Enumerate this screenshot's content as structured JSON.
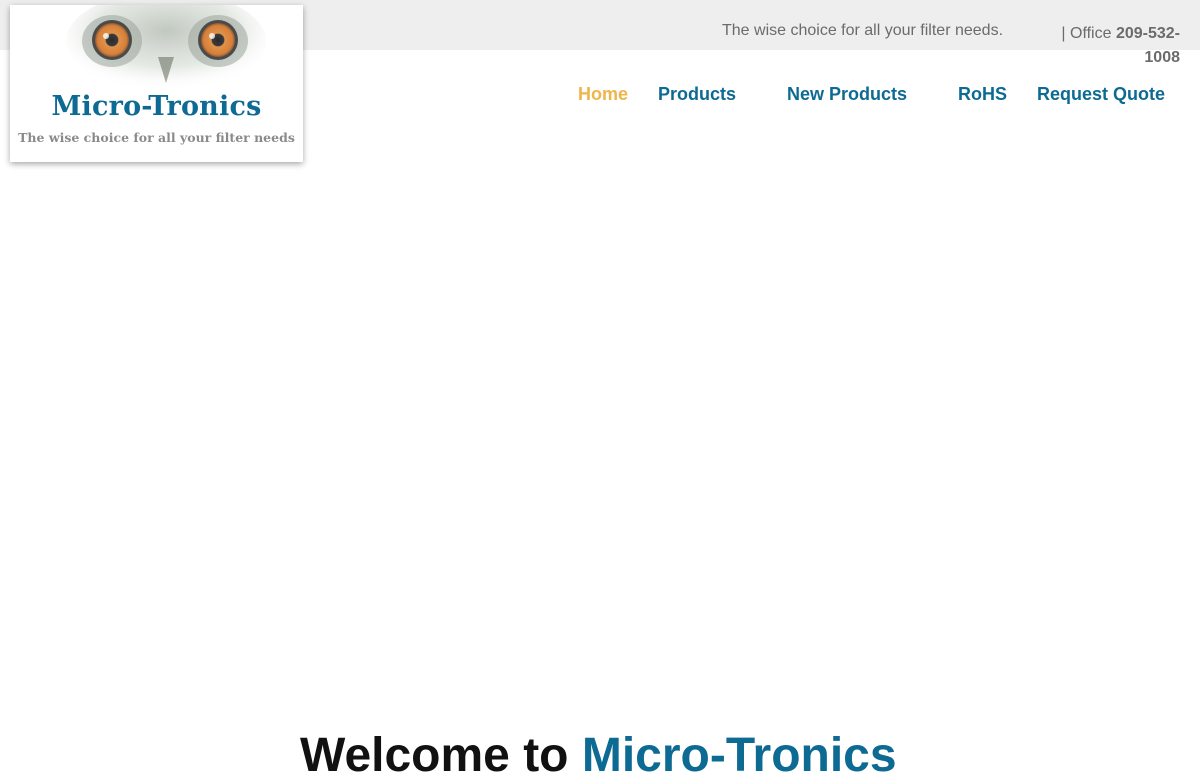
{
  "header": {
    "tagline": "The wise choice for all your filter needs.",
    "office_label": "| Office",
    "office_phone": "209-532-1008"
  },
  "logo": {
    "icon": "owl-eyes-icon",
    "name": "Micro-Tronics",
    "subtitle": "The wise choice for all your filter needs"
  },
  "nav": {
    "items": [
      {
        "label": "Home",
        "active": true
      },
      {
        "label": "Products",
        "active": false
      },
      {
        "label": "New Products",
        "active": false
      },
      {
        "label": "RoHS",
        "active": false
      },
      {
        "label": "Request Quote",
        "active": false
      }
    ]
  },
  "hero": {
    "welcome_prefix": "Welcome to",
    "welcome_brand": "Micro-Tronics"
  },
  "colors": {
    "brand": "#0d6a93",
    "active_nav": "#f0b549",
    "topbar_bg": "#eeeeee",
    "muted_text": "#6b6b6b"
  }
}
